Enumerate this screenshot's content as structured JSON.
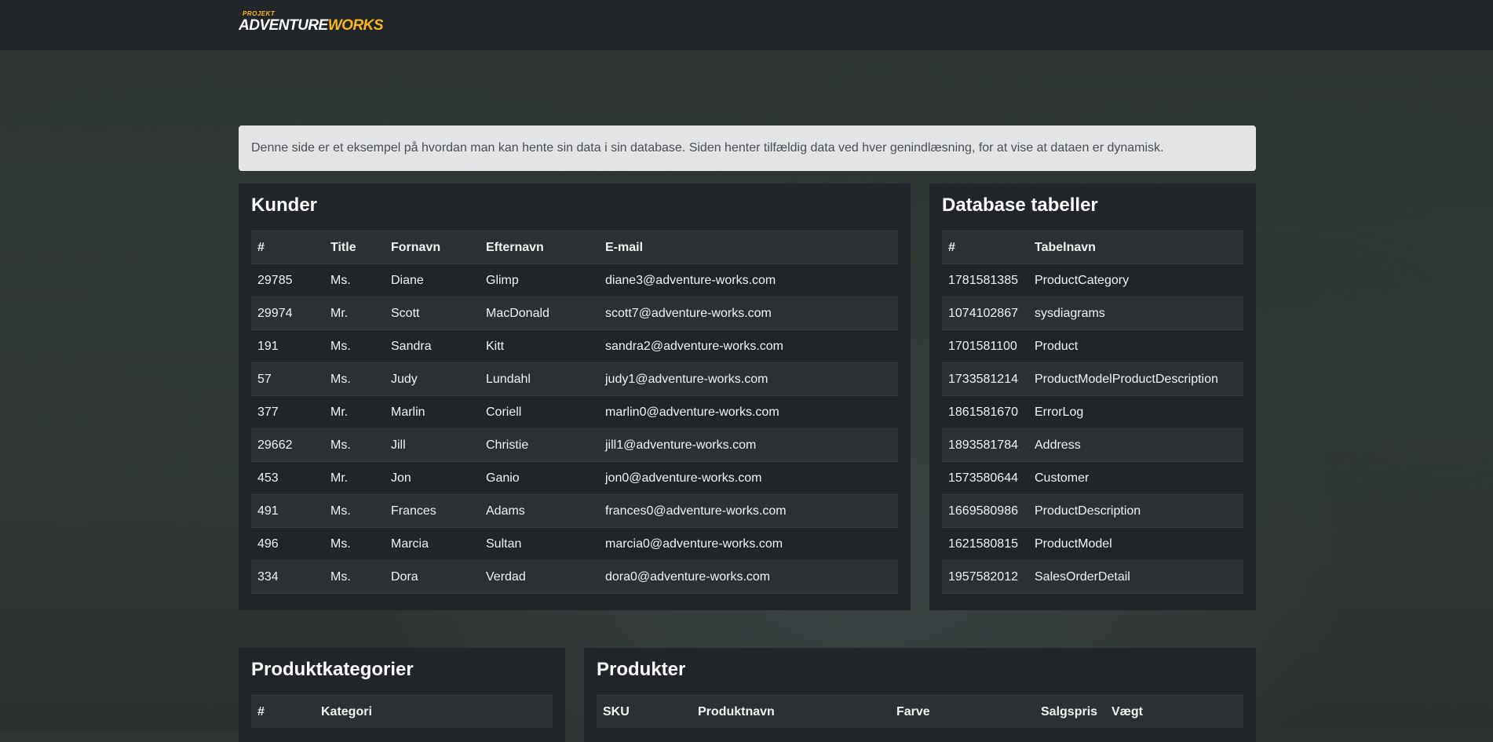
{
  "brand": {
    "small": "PROJEKT",
    "word1": "ADVENTURE",
    "word2": "WORKS"
  },
  "info": "Denne side er et eksempel på hvordan man kan hente sin data i sin database. Siden henter tilfældig data ved hver genindlæsning, for at vise at dataen er dynamisk.",
  "kunder": {
    "title": "Kunder",
    "headers": [
      "#",
      "Title",
      "Fornavn",
      "Efternavn",
      "E-mail"
    ],
    "rows": [
      [
        "29785",
        "Ms.",
        "Diane",
        "Glimp",
        "diane3@adventure-works.com"
      ],
      [
        "29974",
        "Mr.",
        "Scott",
        "MacDonald",
        "scott7@adventure-works.com"
      ],
      [
        "191",
        "Ms.",
        "Sandra",
        "Kitt",
        "sandra2@adventure-works.com"
      ],
      [
        "57",
        "Ms.",
        "Judy",
        "Lundahl",
        "judy1@adventure-works.com"
      ],
      [
        "377",
        "Mr.",
        "Marlin",
        "Coriell",
        "marlin0@adventure-works.com"
      ],
      [
        "29662",
        "Ms.",
        "Jill",
        "Christie",
        "jill1@adventure-works.com"
      ],
      [
        "453",
        "Mr.",
        "Jon",
        "Ganio",
        "jon0@adventure-works.com"
      ],
      [
        "491",
        "Ms.",
        "Frances",
        "Adams",
        "frances0@adventure-works.com"
      ],
      [
        "496",
        "Ms.",
        "Marcia",
        "Sultan",
        "marcia0@adventure-works.com"
      ],
      [
        "334",
        "Ms.",
        "Dora",
        "Verdad",
        "dora0@adventure-works.com"
      ]
    ]
  },
  "tabeller": {
    "title": "Database tabeller",
    "headers": [
      "#",
      "Tabelnavn"
    ],
    "rows": [
      [
        "1781581385",
        "ProductCategory"
      ],
      [
        "1074102867",
        "sysdiagrams"
      ],
      [
        "1701581100",
        "Product"
      ],
      [
        "1733581214",
        "ProductModelProductDescription"
      ],
      [
        "1861581670",
        "ErrorLog"
      ],
      [
        "1893581784",
        "Address"
      ],
      [
        "1573580644",
        "Customer"
      ],
      [
        "1669580986",
        "ProductDescription"
      ],
      [
        "1621580815",
        "ProductModel"
      ],
      [
        "1957582012",
        "SalesOrderDetail"
      ]
    ]
  },
  "kategorier": {
    "title": "Produktkategorier",
    "headers": [
      "#",
      "Kategori"
    ]
  },
  "produkter": {
    "title": "Produkter",
    "headers": [
      "SKU",
      "Produktnavn",
      "Farve",
      "Salgspris",
      "Vægt"
    ]
  }
}
